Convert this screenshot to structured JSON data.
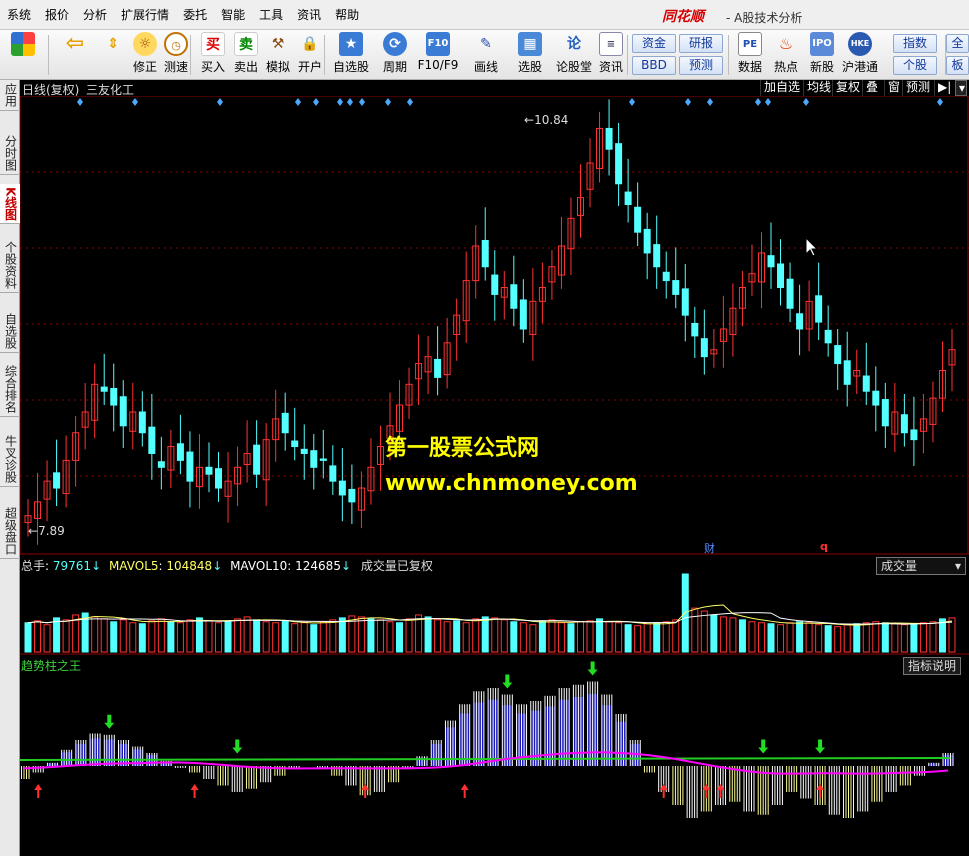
{
  "menu": [
    "系统",
    "报价",
    "分析",
    "扩展行情",
    "委托",
    "智能",
    "工具",
    "资讯",
    "帮助"
  ],
  "brand": "同花顺",
  "app_title": "- A股技术分析",
  "toolbar": {
    "buttons": [
      {
        "label": "",
        "icon": "grid-icon"
      },
      {
        "label": "",
        "icon": "back-arrow-icon"
      },
      {
        "label": "",
        "icon": "up-down-arrow-icon"
      },
      {
        "label": "修正",
        "icon": "adjust-icon"
      },
      {
        "label": "测速",
        "icon": "clock-icon"
      },
      {
        "label": "买入",
        "icon": "buy-icon",
        "glyph": "买"
      },
      {
        "label": "卖出",
        "icon": "sell-icon",
        "glyph": "卖"
      },
      {
        "label": "模拟",
        "icon": "gavel-icon"
      },
      {
        "label": "开户",
        "icon": "lock-icon"
      },
      {
        "label": "自选股",
        "icon": "star-folder-icon"
      },
      {
        "label": "周期",
        "icon": "cycle-icon"
      },
      {
        "label": "F10/F9",
        "icon": "f10-icon"
      },
      {
        "label": "画线",
        "icon": "pen-icon"
      },
      {
        "label": "选股",
        "icon": "picker-icon"
      },
      {
        "label": "论股堂",
        "icon": "forum-icon",
        "glyph": "论"
      },
      {
        "label": "资讯",
        "icon": "news-icon"
      }
    ],
    "small_buttons": [
      "资金",
      "研报",
      "BBD",
      "预测"
    ],
    "right_buttons": [
      {
        "label": "数据",
        "icon": "pe-icon",
        "glyph": "PE"
      },
      {
        "label": "热点",
        "icon": "hot-icon"
      },
      {
        "label": "新股",
        "icon": "ipo-icon"
      },
      {
        "label": "沪港通",
        "icon": "hk-icon",
        "glyph": "HKE"
      }
    ],
    "edge_buttons": [
      "指数",
      "全球",
      "个股",
      "板块"
    ]
  },
  "left_tabs": [
    {
      "label": "应用",
      "active": false
    },
    {
      "label": "分时图",
      "active": false
    },
    {
      "label": "K线图",
      "active": true
    },
    {
      "label": "个股资料",
      "active": false
    },
    {
      "label": "自选股",
      "active": false
    },
    {
      "label": "综合排名",
      "active": false
    },
    {
      "label": "牛叉诊股",
      "active": false
    },
    {
      "label": "超级盘口",
      "active": false
    }
  ],
  "chart_header": {
    "period": "日线(复权)",
    "stock_name": "三友化工",
    "buttons": [
      "加自选",
      "均线",
      "复权",
      "叠",
      "窗",
      "预测"
    ]
  },
  "price_panel": {
    "high_label": "10.84",
    "low_label": "7.89",
    "marker_cai": "财",
    "marker_q": "q"
  },
  "volume_panel": {
    "total_label": "总手",
    "total_value": "79761",
    "ma5_label": "MAVOL5",
    "ma5_value": "104848",
    "ma10_label": "MAVOL10",
    "ma10_value": "124685",
    "arrow": "↓",
    "note": "成交量已复权",
    "selector": "成交量"
  },
  "indicator_panel": {
    "name": "趋势柱之王",
    "help_button": "指标说明"
  },
  "watermark": {
    "line1": "第一股票公式网",
    "line2": "www.chnmoney.com"
  },
  "colors": {
    "up": "#ff3232",
    "down": "#54ffff",
    "grid": "#8b0000",
    "indicator_blue": "#1a1ab4",
    "indicator_line": "#ff00ff"
  },
  "chart_data": {
    "type": "candlestick",
    "high": 10.84,
    "low": 7.89,
    "closes": [
      7.95,
      8.05,
      8.2,
      8.15,
      8.35,
      8.55,
      8.7,
      8.9,
      8.85,
      8.75,
      8.6,
      8.7,
      8.55,
      8.4,
      8.3,
      8.45,
      8.35,
      8.2,
      8.3,
      8.25,
      8.15,
      8.2,
      8.3,
      8.4,
      8.25,
      8.5,
      8.65,
      8.55,
      8.45,
      8.4,
      8.3,
      8.35,
      8.2,
      8.1,
      8.05,
      8.15,
      8.3,
      8.45,
      8.6,
      8.75,
      8.9,
      9.05,
      9.1,
      8.95,
      9.2,
      9.4,
      9.65,
      9.9,
      9.75,
      9.55,
      9.6,
      9.45,
      9.3,
      9.5,
      9.6,
      9.75,
      9.9,
      10.1,
      10.25,
      10.5,
      10.75,
      10.6,
      10.35,
      10.2,
      10.0,
      9.85,
      9.75,
      9.65,
      9.55,
      9.4,
      9.25,
      9.1,
      9.15,
      9.3,
      9.45,
      9.6,
      9.7,
      9.85,
      9.75,
      9.6,
      9.45,
      9.3,
      9.5,
      9.35,
      9.2,
      9.05,
      8.9,
      9.0,
      8.85,
      8.75,
      8.6,
      8.7,
      8.55,
      8.5,
      8.65,
      8.8,
      9.0,
      9.15
    ],
    "volumes": [
      30,
      32,
      28,
      35,
      33,
      38,
      40,
      36,
      34,
      31,
      33,
      30,
      29,
      32,
      34,
      31,
      30,
      33,
      35,
      32,
      30,
      31,
      34,
      36,
      33,
      31,
      30,
      32,
      29,
      30,
      28,
      31,
      33,
      35,
      37,
      36,
      34,
      33,
      31,
      30,
      34,
      38,
      36,
      33,
      31,
      32,
      30,
      34,
      36,
      35,
      33,
      31,
      30,
      28,
      32,
      33,
      30,
      29,
      31,
      32,
      34,
      31,
      30,
      28,
      27,
      29,
      30,
      31,
      33,
      80,
      45,
      42,
      38,
      36,
      35,
      33,
      31,
      30,
      29,
      28,
      30,
      31,
      30,
      28,
      27,
      26,
      28,
      29,
      30,
      31,
      30,
      29,
      28,
      29,
      30,
      31,
      34,
      35
    ],
    "indicator": [
      -20,
      -10,
      5,
      25,
      40,
      50,
      48,
      40,
      30,
      20,
      8,
      -3,
      -10,
      -20,
      -30,
      -40,
      -35,
      -25,
      -15,
      -5,
      0,
      -5,
      -15,
      -30,
      -45,
      -40,
      -25,
      -5,
      15,
      40,
      70,
      95,
      115,
      120,
      110,
      95,
      100,
      108,
      120,
      125,
      130,
      110,
      80,
      40,
      -10,
      -40,
      -60,
      -80,
      -70,
      -60,
      -55,
      -70,
      -75,
      -60,
      -40,
      -50,
      -60,
      -75,
      -80,
      -70,
      -55,
      -40,
      -30,
      -15,
      5,
      20
    ],
    "buy_signals": [
      1,
      12,
      24,
      31,
      45,
      48,
      49,
      56
    ],
    "sell_signals": [
      6,
      15,
      34,
      40,
      52,
      56
    ]
  }
}
